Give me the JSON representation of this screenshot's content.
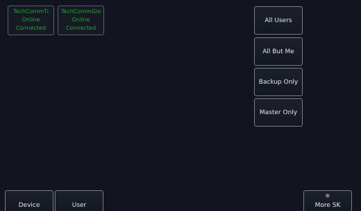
{
  "devices": [
    {
      "name": "TechCommTi",
      "status": "Online",
      "connection": "Connected"
    },
    {
      "name": "TechCommGio",
      "status": "Online",
      "connection": "Connected"
    }
  ],
  "target_buttons": {
    "all_users": "All Users",
    "all_but_me": "All But Me",
    "backup_only": "Backup Only",
    "master_only": "Master Only"
  },
  "softkeys": {
    "device": "Device",
    "user": "User",
    "more": "More SK"
  },
  "colors": {
    "background": "#12151f",
    "status_green": "#26a43a",
    "button_border": "#7a7d86"
  }
}
